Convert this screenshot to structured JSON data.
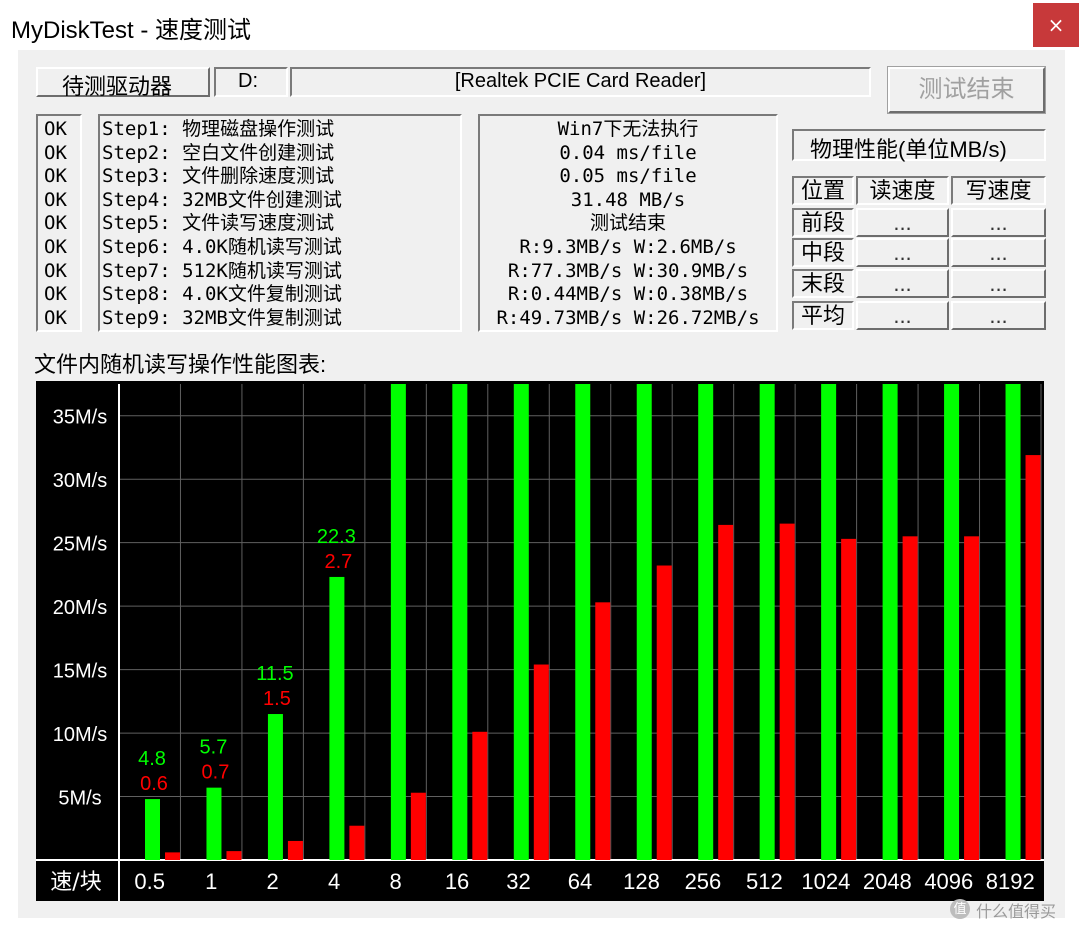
{
  "window": {
    "title": "MyDiskTest - 速度测试",
    "close_label": "×"
  },
  "drive": {
    "label": "待测驱动器",
    "letter": "D:",
    "name": "[Realtek PCIE Card Reader]"
  },
  "end_button": "测试结束",
  "steps": {
    "status": [
      "OK",
      "OK",
      "OK",
      "OK",
      "OK",
      "OK",
      "OK",
      "OK",
      "OK"
    ],
    "names": [
      "Step1: 物理磁盘操作测试",
      "Step2: 空白文件创建测试",
      "Step3: 文件删除速度测试",
      "Step4: 32MB文件创建测试",
      "Step5: 文件读写速度测试",
      "Step6: 4.0K随机读写测试",
      "Step7: 512K随机读写测试",
      "Step8: 4.0K文件复制测试",
      "Step9: 32MB文件复制测试"
    ],
    "results": [
      "Win7下无法执行",
      "0.04 ms/file",
      "0.05 ms/file",
      "31.48 MB/s",
      "测试结束",
      "R:9.3MB/s W:2.6MB/s",
      "R:77.3MB/s W:30.9MB/s",
      "R:0.44MB/s W:0.38MB/s",
      "R:49.73MB/s W:26.72MB/s"
    ]
  },
  "physical": {
    "title": "物理性能(单位MB/s)",
    "headers": [
      "位置",
      "读速度",
      "写速度"
    ],
    "rows": [
      {
        "pos": "前段",
        "read": "...",
        "write": "..."
      },
      {
        "pos": "中段",
        "read": "...",
        "write": "..."
      },
      {
        "pos": "末段",
        "read": "...",
        "write": "..."
      },
      {
        "pos": "平均",
        "read": "...",
        "write": "..."
      }
    ]
  },
  "chart_section_label": "文件内随机读写操作性能图表:",
  "chart_data": {
    "type": "bar",
    "xlabel": "速/块",
    "ylabel": "",
    "ylim": [
      0,
      37.5
    ],
    "yticks": [
      "5M/s",
      "10M/s",
      "15M/s",
      "20M/s",
      "25M/s",
      "30M/s",
      "35M/s"
    ],
    "ytick_values": [
      5,
      10,
      15,
      20,
      25,
      30,
      35
    ],
    "categories": [
      "0.5",
      "1",
      "2",
      "4",
      "8",
      "16",
      "32",
      "64",
      "128",
      "256",
      "512",
      "1024",
      "2048",
      "4096",
      "8192"
    ],
    "series": [
      {
        "color": "#00ff00",
        "values": [
          4.8,
          5.7,
          11.5,
          22.3,
          40,
          40,
          40,
          40,
          40,
          40,
          40,
          40,
          40,
          40,
          40
        ]
      },
      {
        "color": "#ff0000",
        "values": [
          0.6,
          0.7,
          1.5,
          2.7,
          5.3,
          10.1,
          15.4,
          20.3,
          23.2,
          26.4,
          26.5,
          25.3,
          25.5,
          25.5,
          31.9
        ]
      }
    ],
    "data_labels": [
      {
        "index": 0,
        "read": "4.8",
        "write": "0.6"
      },
      {
        "index": 1,
        "read": "5.7",
        "write": "0.7"
      },
      {
        "index": 2,
        "read": "11.5",
        "write": "1.5"
      },
      {
        "index": 3,
        "read": "22.3",
        "write": "2.7"
      }
    ],
    "grid": true,
    "colors": {
      "background": "#000000",
      "grid": "#606060",
      "read": "#00ff00",
      "write": "#ff0000",
      "axis_text": "#ffffff"
    }
  },
  "watermark": {
    "icon": "值",
    "text": "什么值得买"
  }
}
